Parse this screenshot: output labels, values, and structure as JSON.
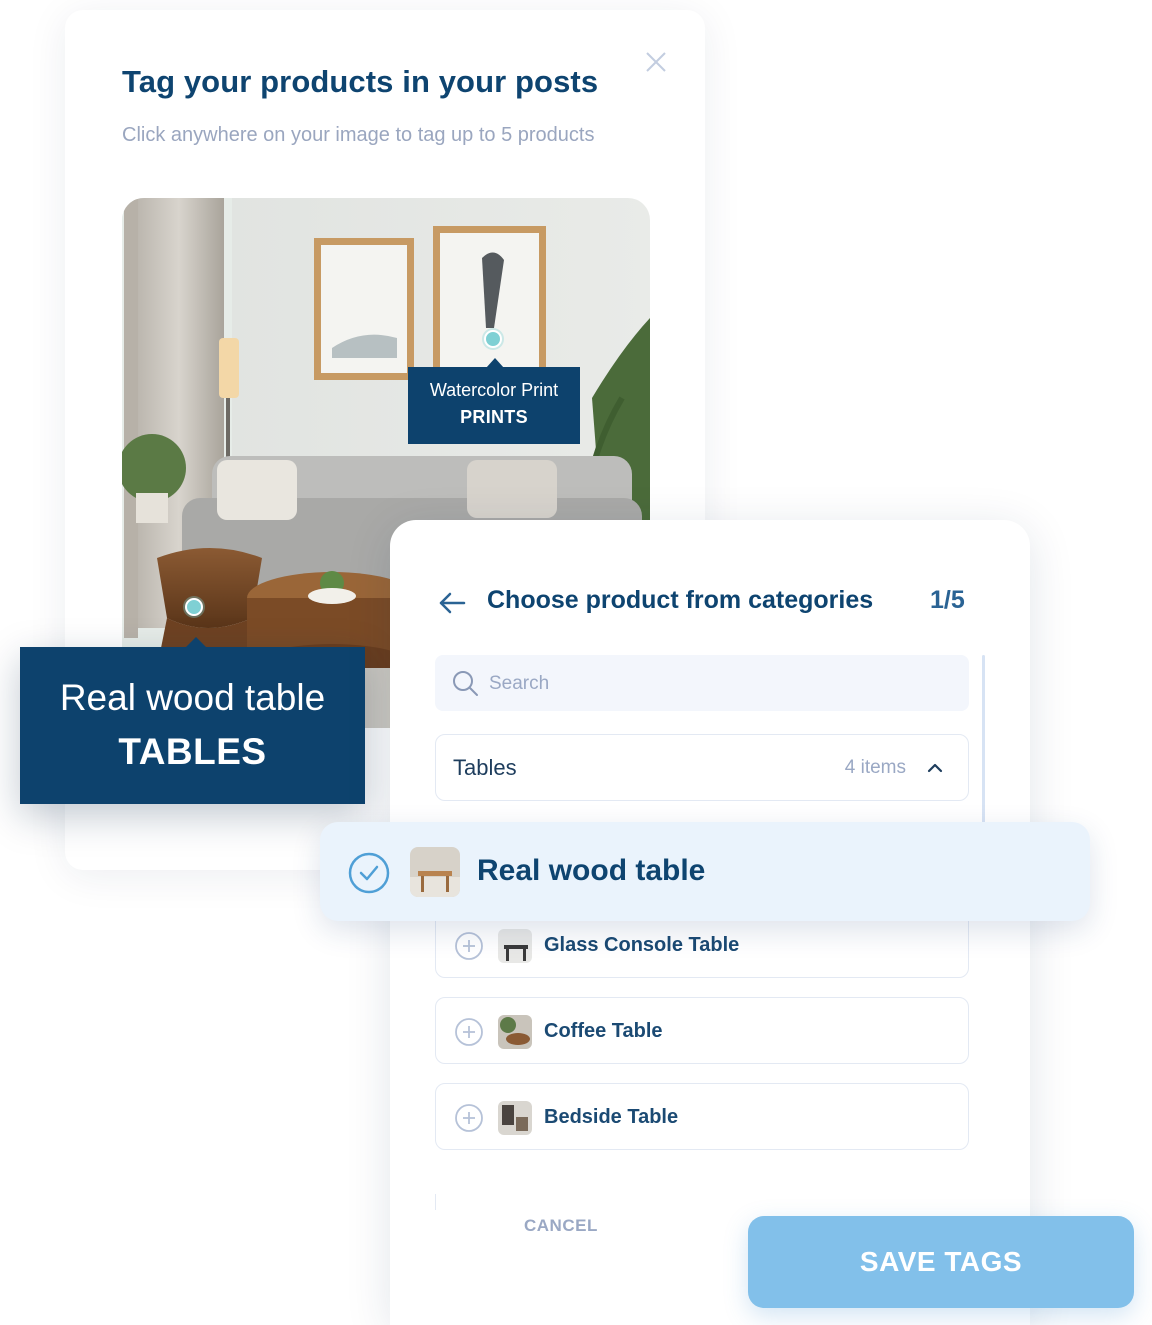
{
  "tag_dialog": {
    "title": "Tag your products in your posts",
    "subtitle": "Click anywhere on your image to tag up to 5 products",
    "close_icon": "close-icon"
  },
  "photo_tags": [
    {
      "name": "Watercolor Print",
      "category": "PRINTS"
    },
    {
      "name": "Real wood table",
      "category": "TABLES"
    }
  ],
  "category_panel": {
    "title": "Choose product from categories",
    "count": "1/5",
    "search_placeholder": "Search",
    "category": {
      "name": "Tables",
      "items": "4 items",
      "expanded": true
    },
    "selected_product": "Real wood table",
    "products": [
      {
        "label": "Glass Console Table"
      },
      {
        "label": "Coffee Table"
      },
      {
        "label": "Bedside Table"
      }
    ],
    "cancel_label": "CANCEL",
    "save_label": "SAVE TAGS"
  },
  "colors": {
    "navy": "#0d426d",
    "accent_teal": "#7fd0d4",
    "save_button": "#82c0ea",
    "selected_row_bg": "#eaf3fc"
  }
}
